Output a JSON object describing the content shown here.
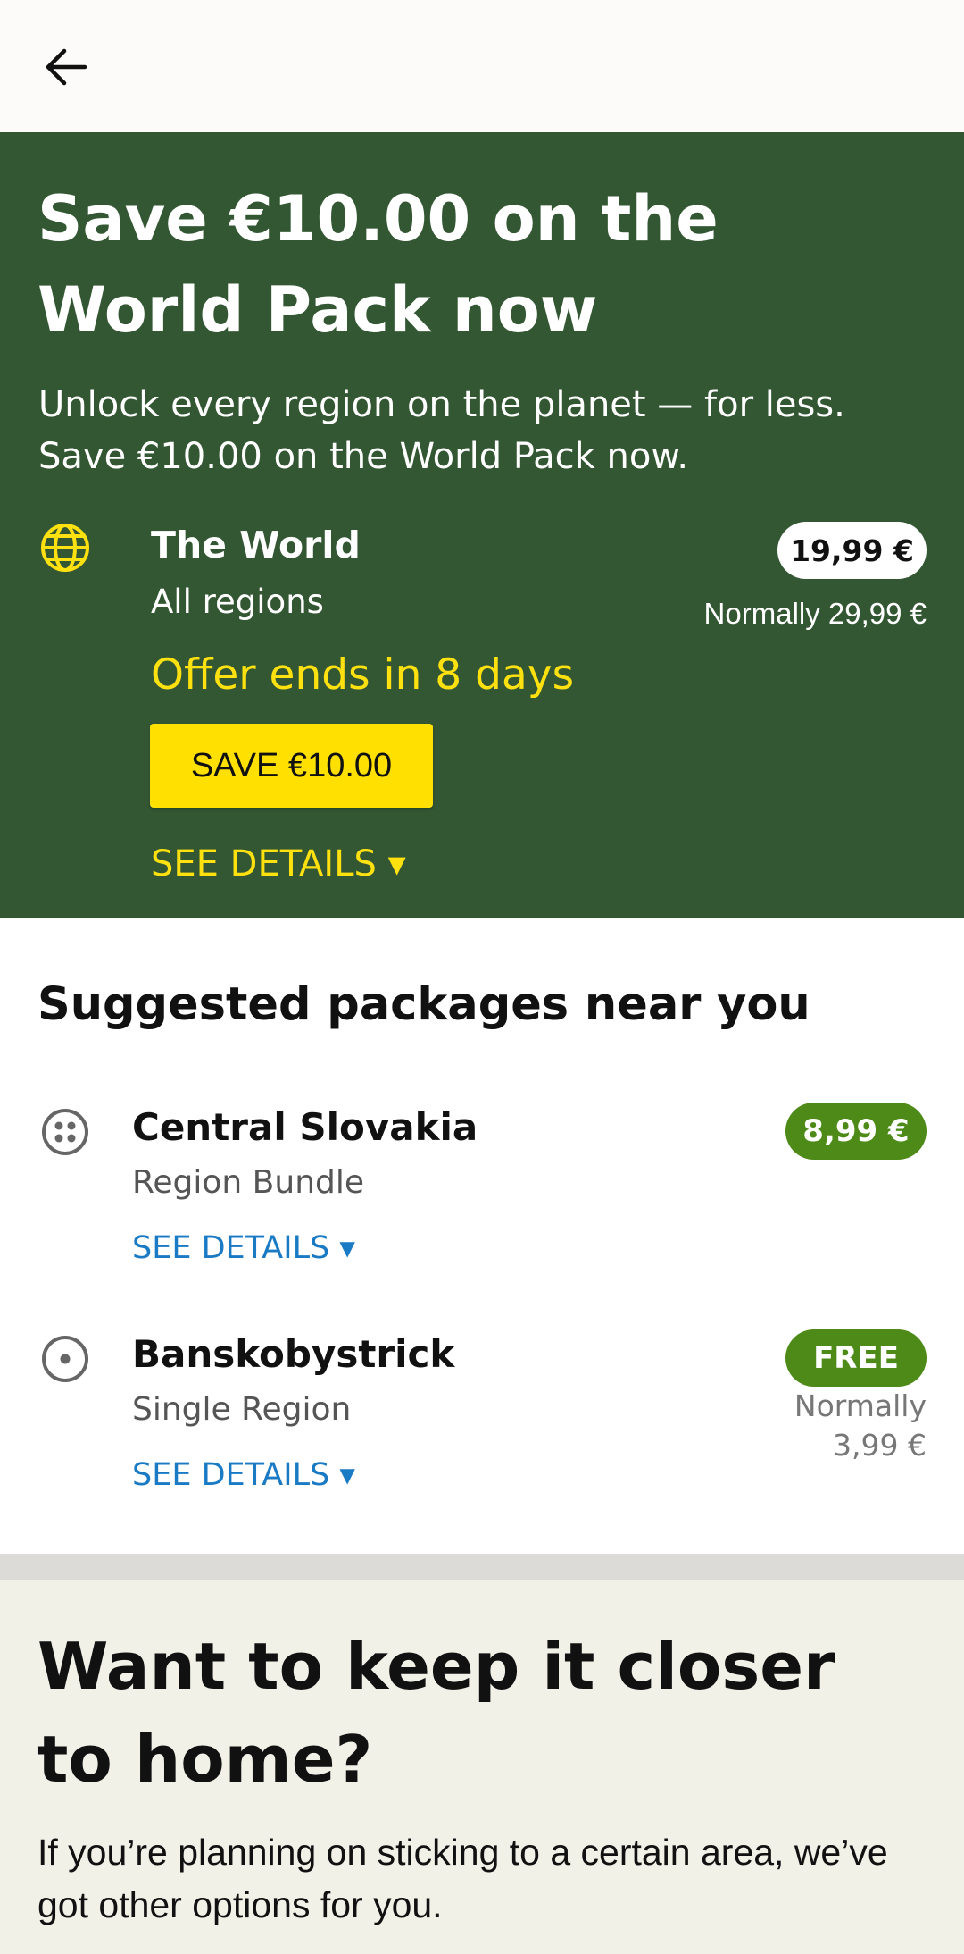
{
  "header": {
    "back_icon": "arrow-left-icon"
  },
  "promo": {
    "title": "Save €10.00 on the World Pack now",
    "subtitle": "Unlock every region on the planet — for less. Save €10.00 on the World Pack now.",
    "pack": {
      "icon": "globe-icon",
      "name": "The World",
      "type": "All regions",
      "price": "19,99 €",
      "normally": "Normally 29,99 €",
      "offer": "Offer ends in 8 days",
      "button_label": "SAVE €10.00",
      "details_label": "SEE DETAILS ▾"
    },
    "colors": {
      "background": "#345733",
      "accent": "#ffe000"
    }
  },
  "suggested": {
    "heading": "Suggested packages near you",
    "items": [
      {
        "icon": "region-bundle-icon",
        "name": "Central Slovakia",
        "type": "Region Bundle",
        "price": "8,99 €",
        "details_label": "SEE DETAILS ▾"
      },
      {
        "icon": "single-region-icon",
        "name": "Banskobystrick",
        "type": "Single Region",
        "price": "FREE",
        "normally_line1": "Normally",
        "normally_line2": "3,99 €",
        "details_label": "SEE DETAILS ▾"
      }
    ],
    "colors": {
      "pill": "#4e8a17",
      "link": "#1a7ac4"
    }
  },
  "closer": {
    "heading": "Want to keep it closer to home?",
    "body": "If you’re planning on sticking to a certain area, we’ve got other options for you."
  }
}
